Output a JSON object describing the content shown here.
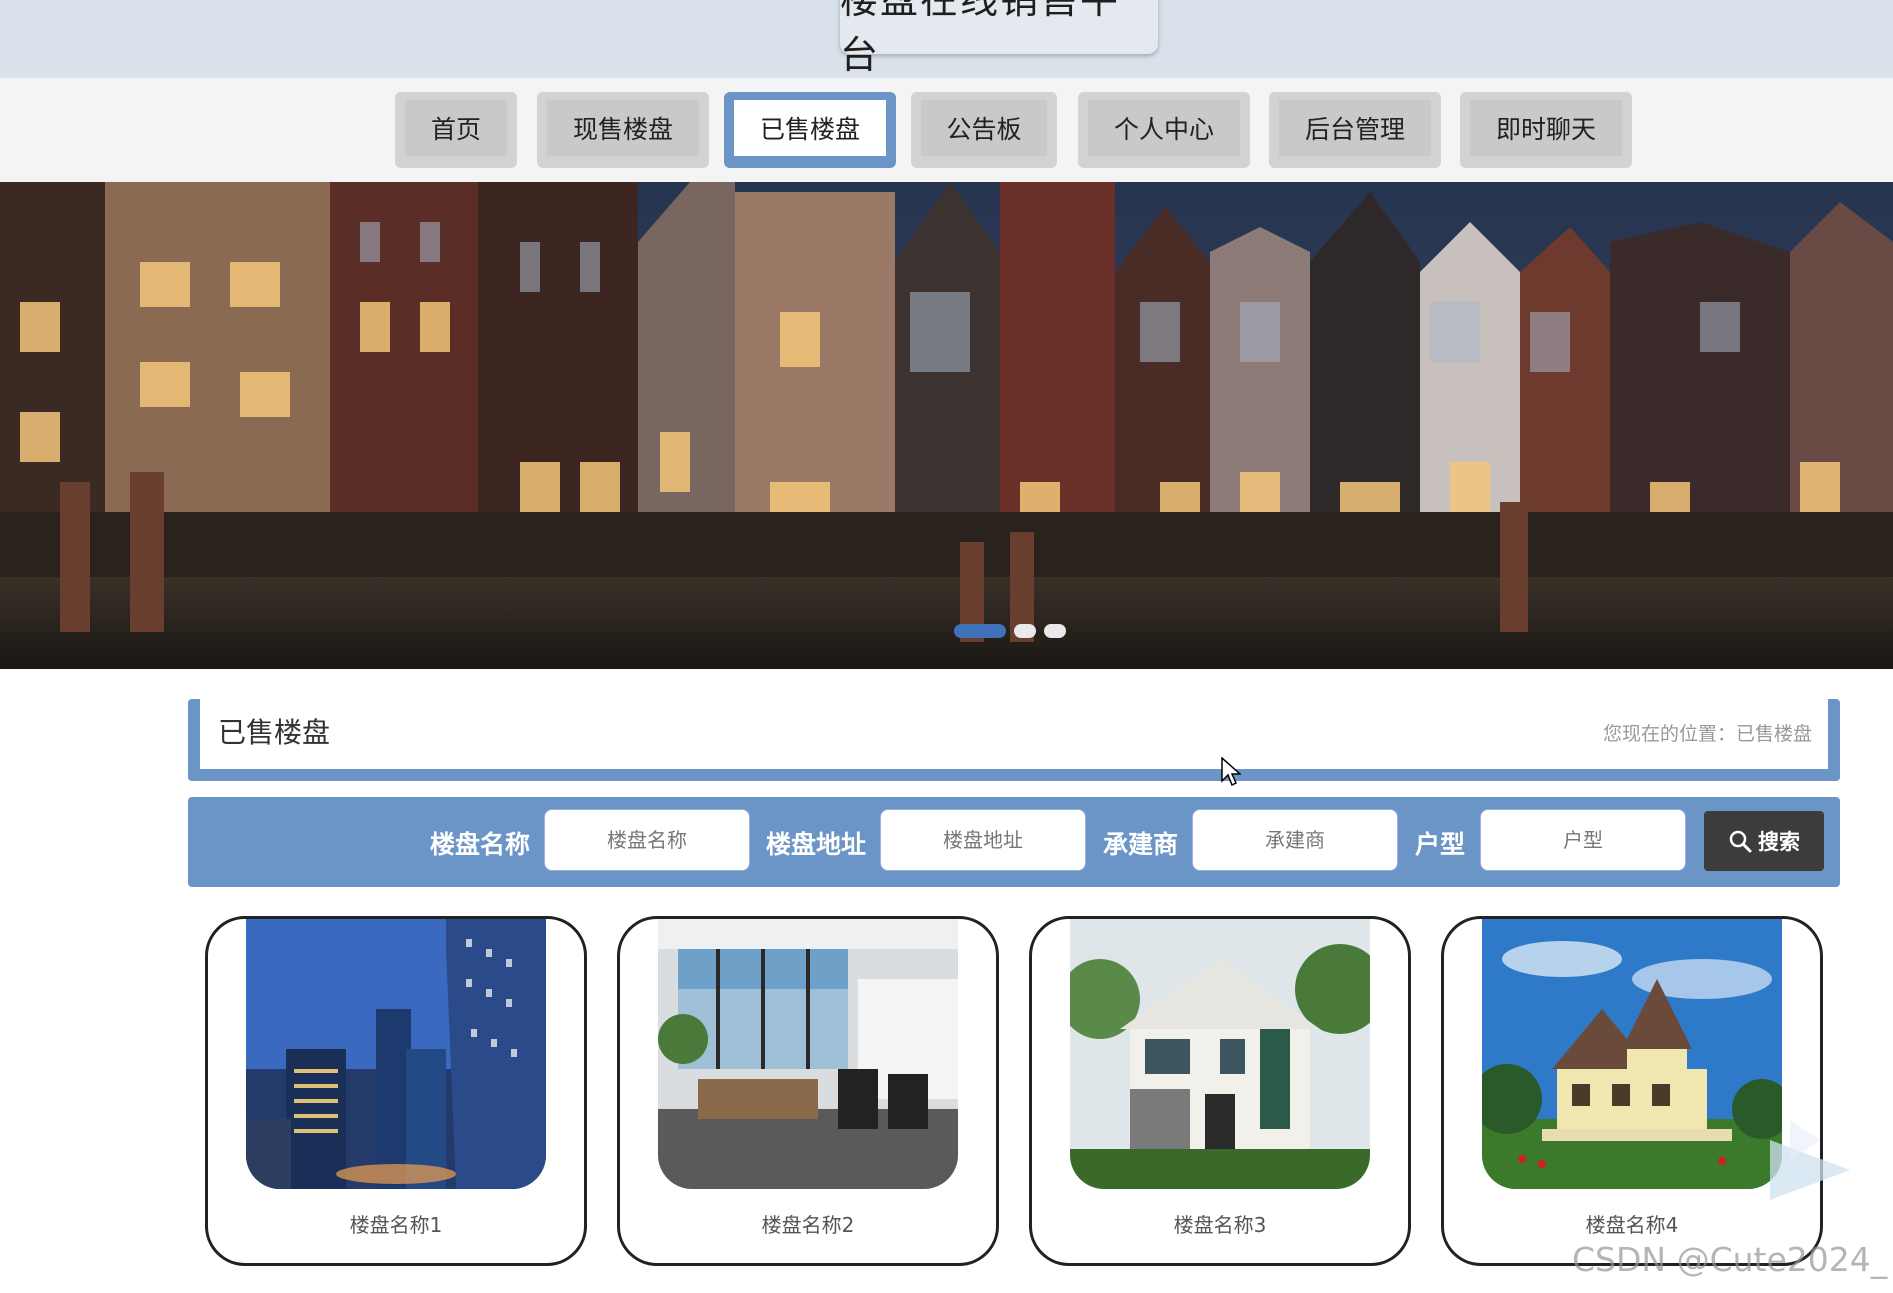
{
  "header": {
    "title": "楼盘在线销售平台"
  },
  "nav": {
    "items": [
      {
        "label": "首页"
      },
      {
        "label": "现售楼盘"
      },
      {
        "label": "已售楼盘"
      },
      {
        "label": "公告板"
      },
      {
        "label": "个人中心"
      },
      {
        "label": "后台管理"
      },
      {
        "label": "即时聊天"
      }
    ],
    "active": "已售楼盘"
  },
  "banner": {
    "slides": 3,
    "active_slide": 1
  },
  "section": {
    "title": "已售楼盘",
    "breadcrumb": "您现在的位置：已售楼盘"
  },
  "search": {
    "fields": [
      {
        "label": "楼盘名称",
        "placeholder": "楼盘名称",
        "value": ""
      },
      {
        "label": "楼盘地址",
        "placeholder": "楼盘地址",
        "value": ""
      },
      {
        "label": "承建商",
        "placeholder": "承建商",
        "value": ""
      },
      {
        "label": "户型",
        "placeholder": "户型",
        "value": ""
      }
    ],
    "button": "搜索"
  },
  "listings": [
    {
      "name": "楼盘名称1",
      "image": "office-towers-night"
    },
    {
      "name": "楼盘名称2",
      "image": "modern-office-interior"
    },
    {
      "name": "楼盘名称3",
      "image": "white-villa"
    },
    {
      "name": "楼盘名称4",
      "image": "victorian-house"
    }
  ],
  "watermark": "CSDN @Cute2024_",
  "colors": {
    "accent": "#6b94c7",
    "header_bg": "#d9e1ea",
    "search_button": "#3c3c3c",
    "dot_active": "#3f72b8"
  }
}
